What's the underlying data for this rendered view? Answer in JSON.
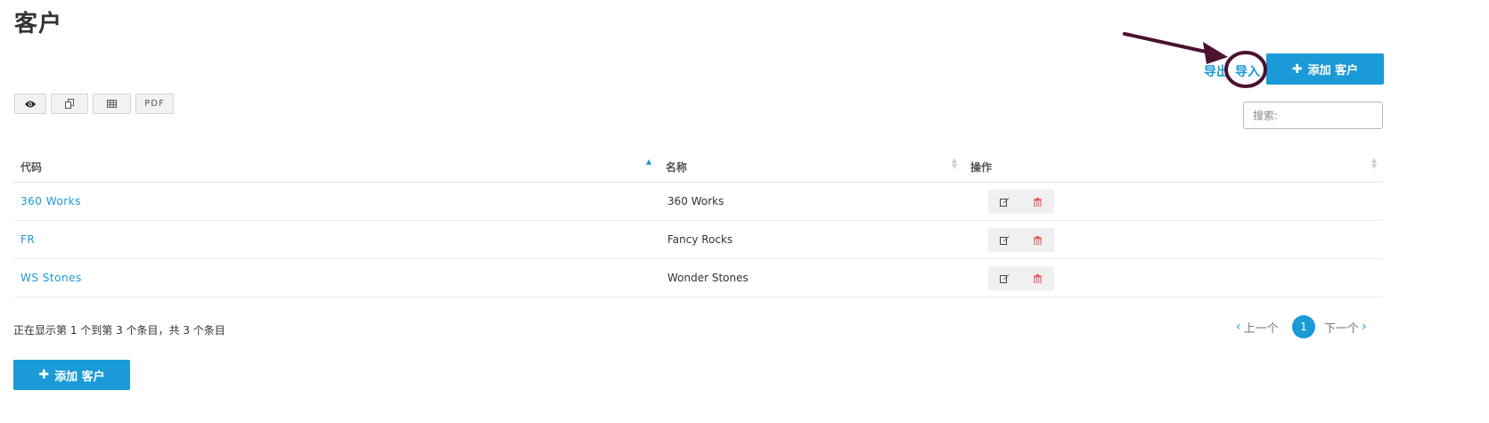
{
  "page": {
    "title": "客户"
  },
  "header_actions": {
    "export_label": "导出",
    "import_label": "导入",
    "add_label": "添加 客户"
  },
  "toolbar": {
    "buttons": [
      {
        "icon": "eye-icon"
      },
      {
        "icon": "copy-icon"
      },
      {
        "icon": "csv-icon"
      },
      {
        "label": "PDF"
      }
    ]
  },
  "search": {
    "placeholder": "搜索:"
  },
  "table": {
    "columns": [
      "代码",
      "名称",
      "操作"
    ],
    "rows": [
      {
        "code": "360 Works",
        "name": "360 Works"
      },
      {
        "code": "FR",
        "name": "Fancy Rocks"
      },
      {
        "code": "WS Stones",
        "name": "Wonder Stones"
      }
    ]
  },
  "footer": {
    "info": "正在显示第 1 个到第 3 个条目，共 3 个条目",
    "prev_label": "上一个",
    "next_label": "下一个",
    "current_page": "1",
    "add_label": "添加 客户"
  },
  "colors": {
    "accent": "#1a9ad6",
    "annotation": "#4a1230",
    "delete": "#e05555"
  }
}
